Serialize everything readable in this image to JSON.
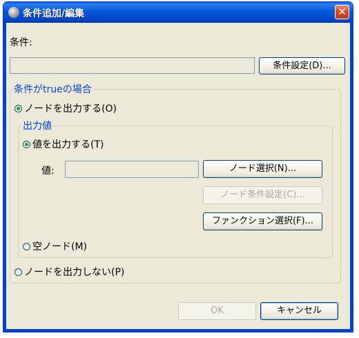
{
  "window": {
    "title": "条件追加/編集",
    "close_glyph": "✕"
  },
  "condition": {
    "label": "条件:",
    "value": "",
    "settings_button": "条件設定(D)..."
  },
  "true_group": {
    "legend": "条件がtrueの場合",
    "radio_output_node": "ノードを出力する(O)",
    "output_value": {
      "legend": "出力値",
      "radio_output_value": "値を出力する(T)",
      "value_label": "値:",
      "value": "",
      "node_select_button": "ノード選択(N)...",
      "node_condition_button": "ノード条件設定(C)...",
      "function_select_button": "ファンクション選択(F)...",
      "radio_empty_node": "空ノード(M)"
    },
    "radio_no_output": "ノードを出力しない(P)"
  },
  "footer": {
    "ok": "OK",
    "cancel": "キャンセル"
  },
  "selection": {
    "true_group": "output_node",
    "output_value": "value"
  },
  "colors": {
    "titlebar": "#0046c8",
    "legend": "#0046d5",
    "radio_dot": "#21a121",
    "close": "#d24a26"
  }
}
